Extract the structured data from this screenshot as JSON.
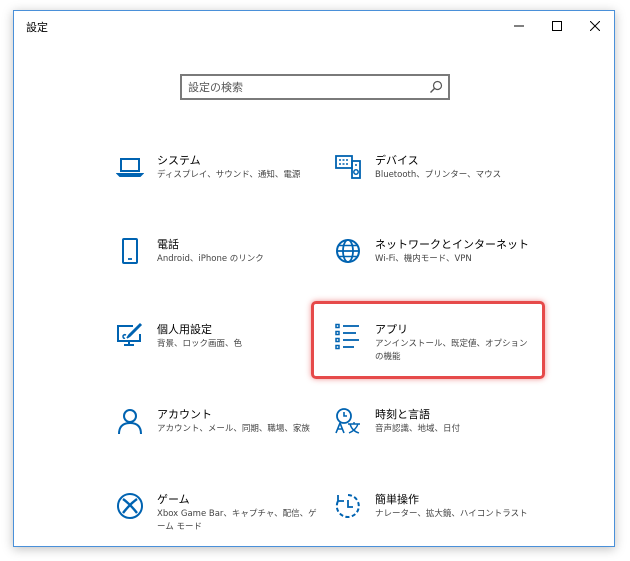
{
  "window": {
    "title": "設定"
  },
  "search": {
    "placeholder": "設定の検索"
  },
  "tiles": [
    {
      "key": "system",
      "name": "システム",
      "desc": "ディスプレイ、サウンド、通知、電源"
    },
    {
      "key": "devices",
      "name": "デバイス",
      "desc": "Bluetooth、プリンター、マウス"
    },
    {
      "key": "phone",
      "name": "電話",
      "desc": "Android、iPhone のリンク"
    },
    {
      "key": "network",
      "name": "ネットワークとインターネット",
      "desc": "Wi-Fi、機内モード、VPN"
    },
    {
      "key": "personalization",
      "name": "個人用設定",
      "desc": "背景、ロック画面、色"
    },
    {
      "key": "apps",
      "name": "アプリ",
      "desc": "アンインストール、既定値、オプションの機能"
    },
    {
      "key": "accounts",
      "name": "アカウント",
      "desc": "アカウント、メール、同期、職場、家族"
    },
    {
      "key": "time-language",
      "name": "時刻と言語",
      "desc": "音声認識、地域、日付"
    },
    {
      "key": "gaming",
      "name": "ゲーム",
      "desc": "Xbox Game Bar、キャプチャ、配信、ゲーム モード"
    },
    {
      "key": "ease-of-access",
      "name": "簡単操作",
      "desc": "ナレーター、拡大鏡、ハイコントラスト"
    }
  ],
  "colors": {
    "accent": "#0063b1",
    "highlight": "#e64a4a",
    "window_border": "#4a90d9"
  }
}
